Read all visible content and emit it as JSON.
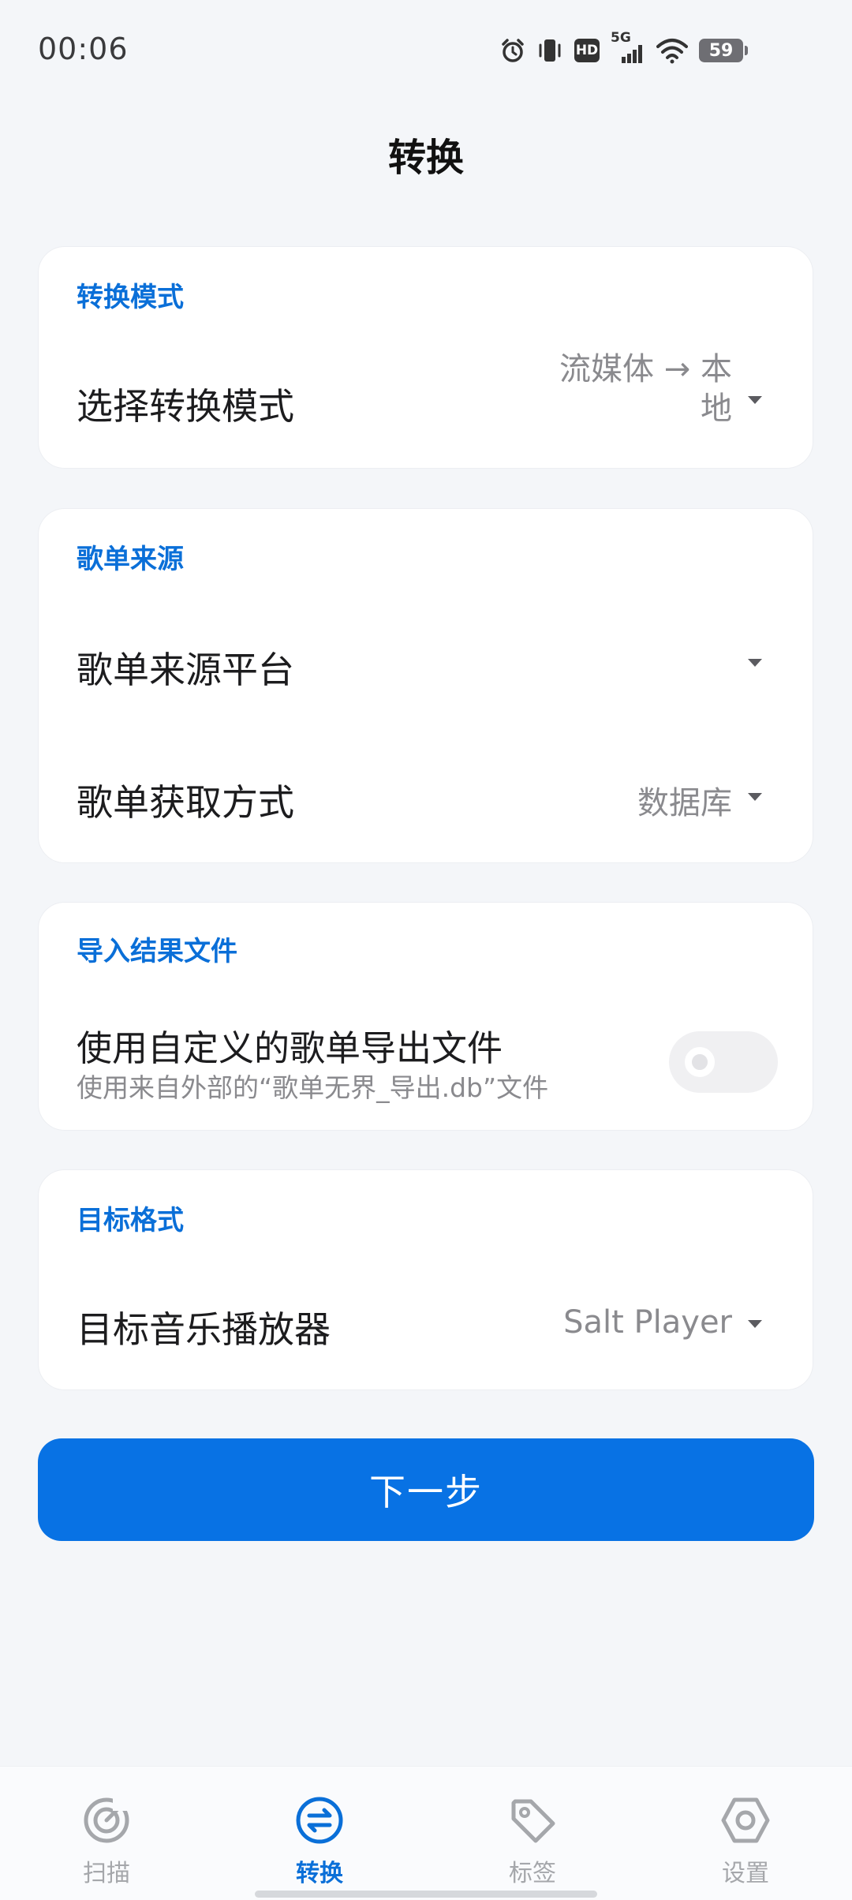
{
  "status_bar": {
    "time": "00:06",
    "network": "5G",
    "hd_badge": "HD",
    "battery": "59"
  },
  "header": {
    "title": "转换"
  },
  "cards": {
    "mode": {
      "header": "转换模式",
      "row_label": "选择转换模式",
      "row_value_line1": "流媒体 → 本",
      "row_value_line2": "地"
    },
    "source": {
      "header": "歌单来源",
      "platform_label": "歌单来源平台",
      "platform_value": "",
      "method_label": "歌单获取方式",
      "method_value": "数据库"
    },
    "import": {
      "header": "导入结果文件",
      "title": "使用自定义的歌单导出文件",
      "subtitle": "使用来自外部的“歌单无界_导出.db”文件",
      "toggle_on": false
    },
    "target": {
      "header": "目标格式",
      "player_label": "目标音乐播放器",
      "player_value": "Salt Player"
    }
  },
  "next_button": {
    "label": "下一步"
  },
  "bottom_nav": {
    "active": "convert",
    "items": [
      {
        "key": "scan",
        "label": "扫描",
        "icon": "scan-icon"
      },
      {
        "key": "convert",
        "label": "转换",
        "icon": "convert-icon"
      },
      {
        "key": "tags",
        "label": "标签",
        "icon": "tag-icon"
      },
      {
        "key": "settings",
        "label": "设置",
        "icon": "settings-icon"
      }
    ]
  },
  "colors": {
    "accent": "#0A6FD8",
    "button": "#0872E4",
    "background": "#F4F6F9",
    "card": "#FFFFFF",
    "muted_text": "#8A8A8E"
  }
}
